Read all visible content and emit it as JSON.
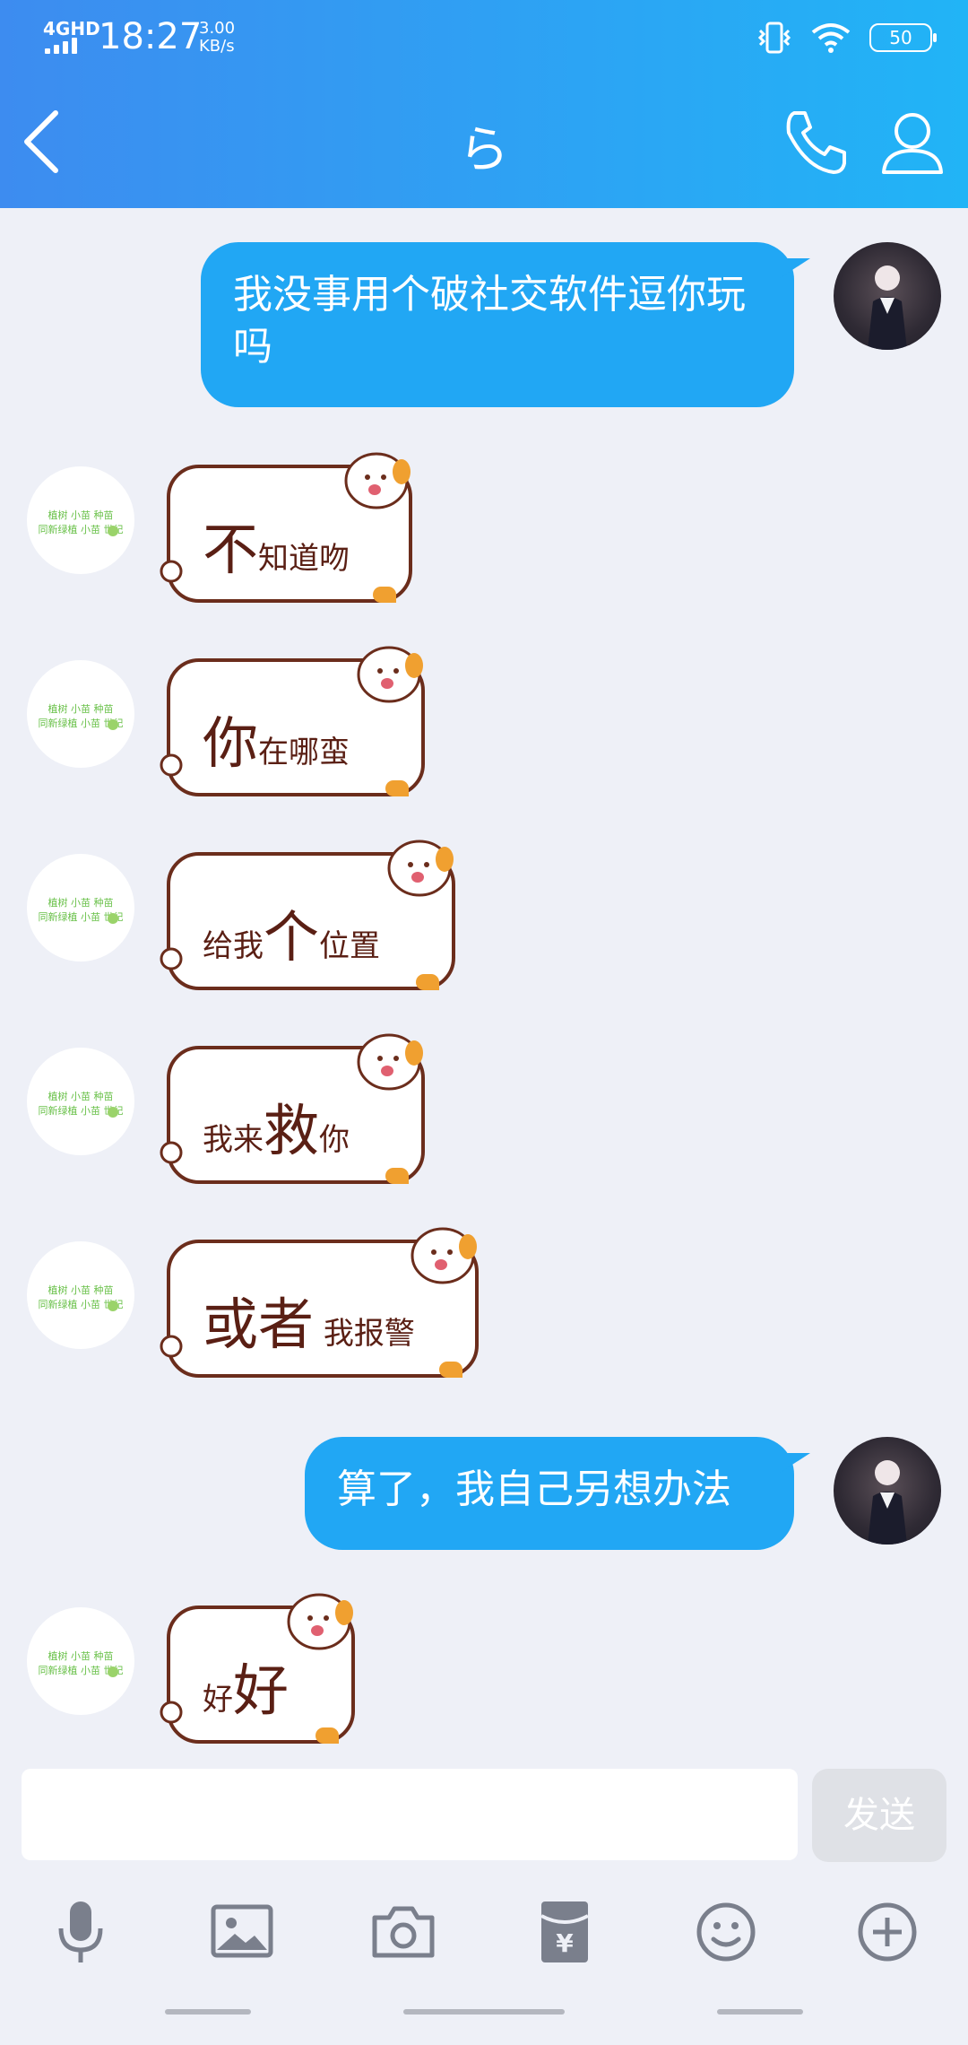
{
  "status_bar": {
    "network": "4GHD",
    "time": "18:27",
    "speed": "3.00 KB/s",
    "battery": "50"
  },
  "header": {
    "title": "ら"
  },
  "messages": [
    {
      "from": "me",
      "text": "我没事用个破社交软件逗你玩吗"
    },
    {
      "from": "them",
      "sticker": [
        "不",
        "知道吻"
      ]
    },
    {
      "from": "them",
      "sticker": [
        "你",
        "在哪蛮"
      ]
    },
    {
      "from": "them",
      "sticker": [
        "给我",
        "个",
        "位置"
      ]
    },
    {
      "from": "them",
      "sticker": [
        "我来",
        "救",
        "你"
      ]
    },
    {
      "from": "them",
      "sticker": [
        "或者",
        "我报警"
      ]
    },
    {
      "from": "me",
      "text": "算了，我自己另想办法"
    },
    {
      "from": "them",
      "sticker": [
        "好",
        "好"
      ]
    }
  ],
  "input": {
    "placeholder": "",
    "send_label": "发送"
  },
  "toolbar": {
    "icons": [
      "mic-icon",
      "image-icon",
      "camera-icon",
      "red-packet-icon",
      "emoji-icon",
      "plus-icon"
    ]
  },
  "colors": {
    "header_start": "#3d8cf0",
    "header_end": "#21b4f6",
    "bubble_me": "#21a7f4",
    "background": "#eef0f7"
  }
}
